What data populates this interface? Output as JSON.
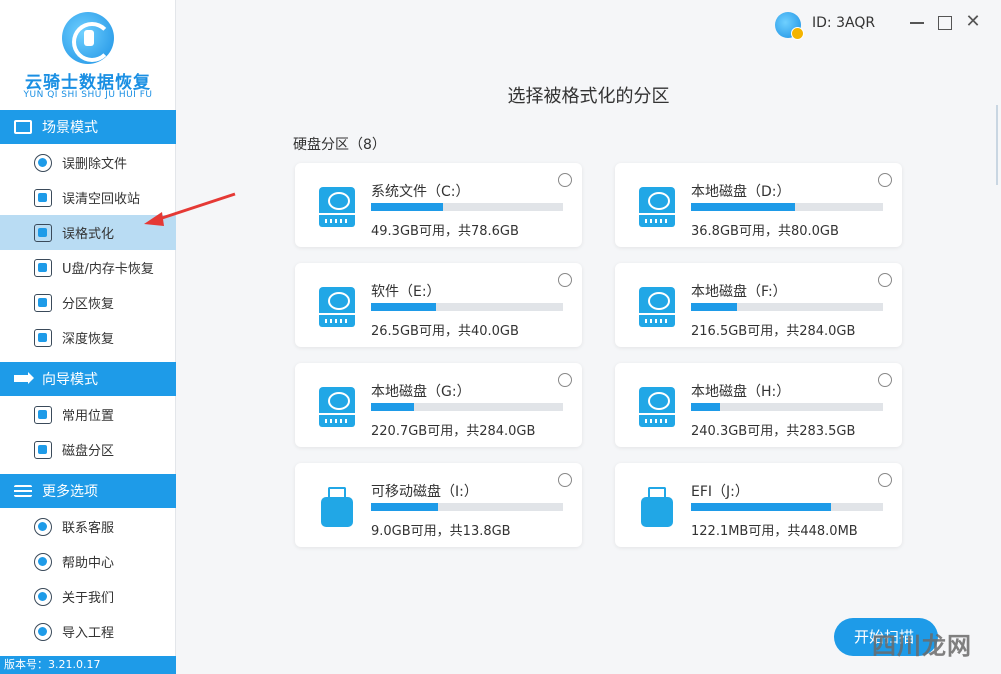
{
  "app": {
    "logo_title": "云骑士数据恢复",
    "logo_subtitle": "YUN QI SHI SHU JU HUI FU",
    "version": "版本号：3.21.0.17",
    "user_id": "ID: 3AQR"
  },
  "sidebar": {
    "sections": [
      {
        "title": "场景模式",
        "icon": "scene-icon",
        "items": [
          {
            "label": "误删除文件",
            "icon": "deleted-file-icon",
            "active": false
          },
          {
            "label": "误清空回收站",
            "icon": "recycle-bin-icon",
            "active": false
          },
          {
            "label": "误格式化",
            "icon": "format-disk-icon",
            "active": true
          },
          {
            "label": "U盘/内存卡恢复",
            "icon": "sd-card-icon",
            "active": false
          },
          {
            "label": "分区恢复",
            "icon": "partition-icon",
            "active": false
          },
          {
            "label": "深度恢复",
            "icon": "deep-recovery-icon",
            "active": false
          }
        ]
      },
      {
        "title": "向导模式",
        "icon": "guide-arrow-icon",
        "items": [
          {
            "label": "常用位置",
            "icon": "windows-icon",
            "active": false
          },
          {
            "label": "磁盘分区",
            "icon": "disk-partition-icon",
            "active": false
          }
        ]
      },
      {
        "title": "更多选项",
        "icon": "menu-icon",
        "items": [
          {
            "label": "联系客服",
            "icon": "phone-icon",
            "active": false
          },
          {
            "label": "帮助中心",
            "icon": "help-icon",
            "active": false
          },
          {
            "label": "关于我们",
            "icon": "info-icon",
            "active": false
          },
          {
            "label": "导入工程",
            "icon": "import-icon",
            "active": false
          }
        ]
      }
    ]
  },
  "main": {
    "title": "选择被格式化的分区",
    "section_label": "硬盘分区（8）",
    "partitions": [
      {
        "name": "系统文件（C:）",
        "capacity": "49.3GB可用，共78.6GB",
        "type": "hdd",
        "used_fraction": 0.373
      },
      {
        "name": "本地磁盘（D:）",
        "capacity": "36.8GB可用，共80.0GB",
        "type": "hdd",
        "used_fraction": 0.54
      },
      {
        "name": "软件（E:）",
        "capacity": "26.5GB可用，共40.0GB",
        "type": "hdd",
        "used_fraction": 0.3375
      },
      {
        "name": "本地磁盘（F:）",
        "capacity": "216.5GB可用，共284.0GB",
        "type": "hdd",
        "used_fraction": 0.238
      },
      {
        "name": "本地磁盘（G:）",
        "capacity": "220.7GB可用，共284.0GB",
        "type": "hdd",
        "used_fraction": 0.223
      },
      {
        "name": "本地磁盘（H:）",
        "capacity": "240.3GB可用，共283.5GB",
        "type": "hdd",
        "used_fraction": 0.152
      },
      {
        "name": "可移动磁盘（I:）",
        "capacity": "9.0GB可用，共13.8GB",
        "type": "usb",
        "used_fraction": 0.348
      },
      {
        "name": "EFI（J:）",
        "capacity": "122.1MB可用，共448.0MB",
        "type": "usb",
        "used_fraction": 0.727
      }
    ],
    "start_button": "开始扫描"
  },
  "watermark": "四川龙网",
  "colors": {
    "accent": "#1e9be8",
    "active_item": "#b9dcf3",
    "annotation": "#e53935"
  }
}
